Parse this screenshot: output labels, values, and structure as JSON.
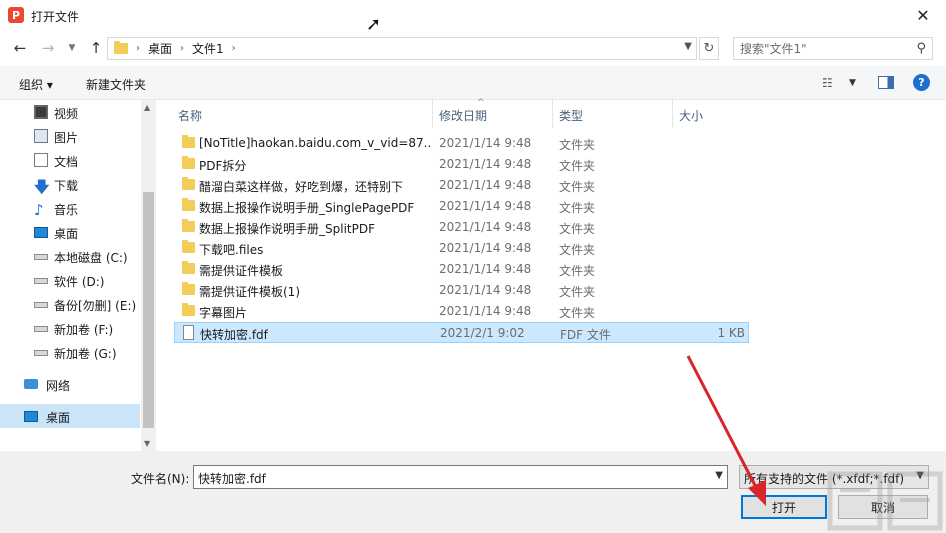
{
  "window": {
    "title": "打开文件",
    "app_icon_letter": "P",
    "close_label": "✕"
  },
  "address": {
    "breadcrumbs": [
      "桌面",
      "文件1"
    ],
    "search_placeholder": "搜索\"文件1\""
  },
  "toolbar": {
    "organize_label": "组织 ▾",
    "new_folder_label": "新建文件夹"
  },
  "nav_pane": {
    "items": [
      {
        "label": "视频",
        "icon": "video-icon"
      },
      {
        "label": "图片",
        "icon": "pictures-icon"
      },
      {
        "label": "文档",
        "icon": "documents-icon"
      },
      {
        "label": "下载",
        "icon": "download-icon"
      },
      {
        "label": "音乐",
        "icon": "music-icon"
      },
      {
        "label": "桌面",
        "icon": "desktop-icon"
      },
      {
        "label": "本地磁盘 (C:)",
        "icon": "drive-icon"
      },
      {
        "label": "软件 (D:)",
        "icon": "drive-icon"
      },
      {
        "label": "备份[勿删] (E:)",
        "icon": "drive-icon"
      },
      {
        "label": "新加卷 (F:)",
        "icon": "drive-icon"
      },
      {
        "label": "新加卷 (G:)",
        "icon": "drive-icon"
      },
      {
        "label": "网络",
        "icon": "network-icon"
      },
      {
        "label": "桌面",
        "icon": "desktop-icon"
      }
    ]
  },
  "columns": {
    "name": "名称",
    "date": "修改日期",
    "type": "类型",
    "size": "大小"
  },
  "files": [
    {
      "name": "[NoTitle]haokan.baidu.com_v_vid=87...",
      "date": "2021/1/14 9:48",
      "type": "文件夹",
      "size": ""
    },
    {
      "name": "PDF拆分",
      "date": "2021/1/14 9:48",
      "type": "文件夹",
      "size": ""
    },
    {
      "name": "醋溜白菜这样做，好吃到爆，还特别下",
      "date": "2021/1/14 9:48",
      "type": "文件夹",
      "size": ""
    },
    {
      "name": "数据上报操作说明手册_SinglePagePDF",
      "date": "2021/1/14 9:48",
      "type": "文件夹",
      "size": ""
    },
    {
      "name": "数据上报操作说明手册_SplitPDF",
      "date": "2021/1/14 9:48",
      "type": "文件夹",
      "size": ""
    },
    {
      "name": "下载吧.files",
      "date": "2021/1/14 9:48",
      "type": "文件夹",
      "size": ""
    },
    {
      "name": "需提供证件模板",
      "date": "2021/1/14 9:48",
      "type": "文件夹",
      "size": ""
    },
    {
      "name": "需提供证件模板(1)",
      "date": "2021/1/14 9:48",
      "type": "文件夹",
      "size": ""
    },
    {
      "name": "字幕图片",
      "date": "2021/1/14 9:48",
      "type": "文件夹",
      "size": ""
    },
    {
      "name": "快转加密.fdf",
      "date": "2021/2/1 9:02",
      "type": "FDF 文件",
      "size": "1 KB"
    }
  ],
  "bottom": {
    "filename_label": "文件名(N):",
    "filename_value": "快转加密.fdf",
    "filter_value": "所有支持的文件 (*.xfdf;*.fdf)",
    "open_label": "打开",
    "cancel_label": "取消"
  },
  "colors": {
    "selection": "#cce8ff",
    "arrow": "#d9262b",
    "folder": "#f3cd5a"
  }
}
